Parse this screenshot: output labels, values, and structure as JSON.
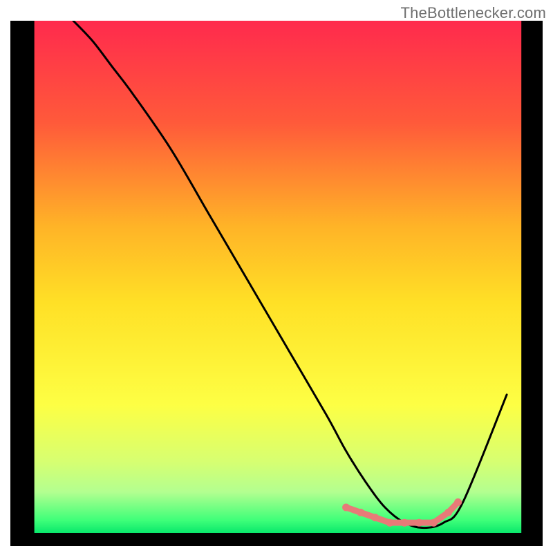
{
  "watermark": "TheBottlenecker.com",
  "chart_data": {
    "type": "line",
    "title": "",
    "xlabel": "",
    "ylabel": "",
    "xlim": [
      0,
      100
    ],
    "ylim": [
      0,
      100
    ],
    "categories_background_gradient": {
      "stops": [
        {
          "offset": 0.0,
          "color": "#ff2a4d"
        },
        {
          "offset": 0.2,
          "color": "#ff5a3a"
        },
        {
          "offset": 0.4,
          "color": "#ffb327"
        },
        {
          "offset": 0.55,
          "color": "#ffe026"
        },
        {
          "offset": 0.75,
          "color": "#fdff44"
        },
        {
          "offset": 0.86,
          "color": "#d7ff71"
        },
        {
          "offset": 0.92,
          "color": "#b3ff90"
        },
        {
          "offset": 0.975,
          "color": "#3fff79"
        },
        {
          "offset": 1.0,
          "color": "#09e86c"
        }
      ]
    },
    "series": [
      {
        "name": "main-curve",
        "color": "#000000",
        "x": [
          8,
          12,
          16,
          20,
          28,
          36,
          44,
          52,
          60,
          64,
          68,
          72,
          76,
          80,
          84,
          88,
          97
        ],
        "values": [
          100,
          96,
          91,
          86,
          75,
          62,
          49,
          36,
          23,
          16,
          10,
          5,
          2,
          1,
          2,
          6,
          27
        ]
      }
    ],
    "highlight": {
      "name": "bottom-dot-band",
      "color": "#e87a78",
      "x": [
        64,
        67,
        70,
        73,
        76,
        79,
        82,
        85,
        87
      ],
      "values": [
        5,
        4,
        3,
        2,
        2,
        2,
        2,
        4,
        6
      ]
    },
    "plot_inset": {
      "left": 4.5,
      "right": 4,
      "top": 0,
      "bottom": 2.5
    }
  }
}
